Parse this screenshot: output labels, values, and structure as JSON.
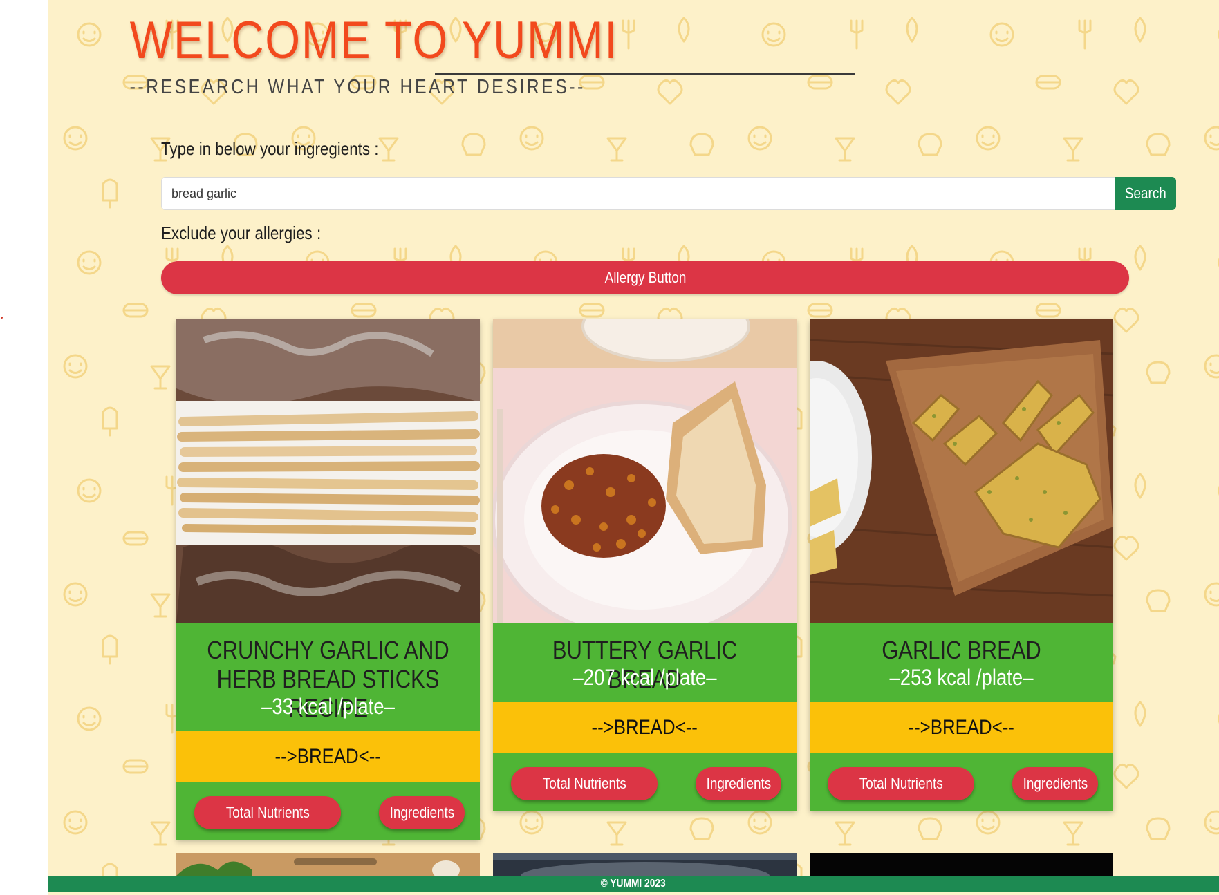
{
  "header": {
    "title": "WELCOME TO YUMMI",
    "subtitle": "--RESEARCH WHAT YOUR HEART DESIRES--"
  },
  "search": {
    "label": "Type in below your ingregients :",
    "value": "bread garlic",
    "button_label": "Search"
  },
  "allergies": {
    "label": "Exclude your allergies :",
    "button_label": "Allergy Button"
  },
  "recipes": [
    {
      "title_line1": "CRUNCHY GARLIC AND",
      "title_line2": "HERB BREAD STICKS RECIPE",
      "kcal": "–33 kcal /plate–",
      "category": "-->BREAD<--",
      "nutrients_label": "Total Nutrients",
      "ingredients_label": "Ingredients"
    },
    {
      "title_line1": "BUTTERY GARLIC BREAD",
      "kcal": "–207 kcal /plate–",
      "category": "-->BREAD<--",
      "nutrients_label": "Total Nutrients",
      "ingredients_label": "Ingredients"
    },
    {
      "title_line1": "GARLIC BREAD",
      "kcal": "–253 kcal /plate–",
      "category": "-->BREAD<--",
      "nutrients_label": "Total Nutrients",
      "ingredients_label": "Ingredients"
    }
  ],
  "footer": {
    "text": "© YUMMI 2023"
  },
  "colors": {
    "background": "#fdf1c9",
    "title": "#f2491d",
    "card_green": "#4fb535",
    "category_yellow": "#fbc109",
    "button_red": "#dc3545",
    "footer_green": "#1d8a52"
  }
}
